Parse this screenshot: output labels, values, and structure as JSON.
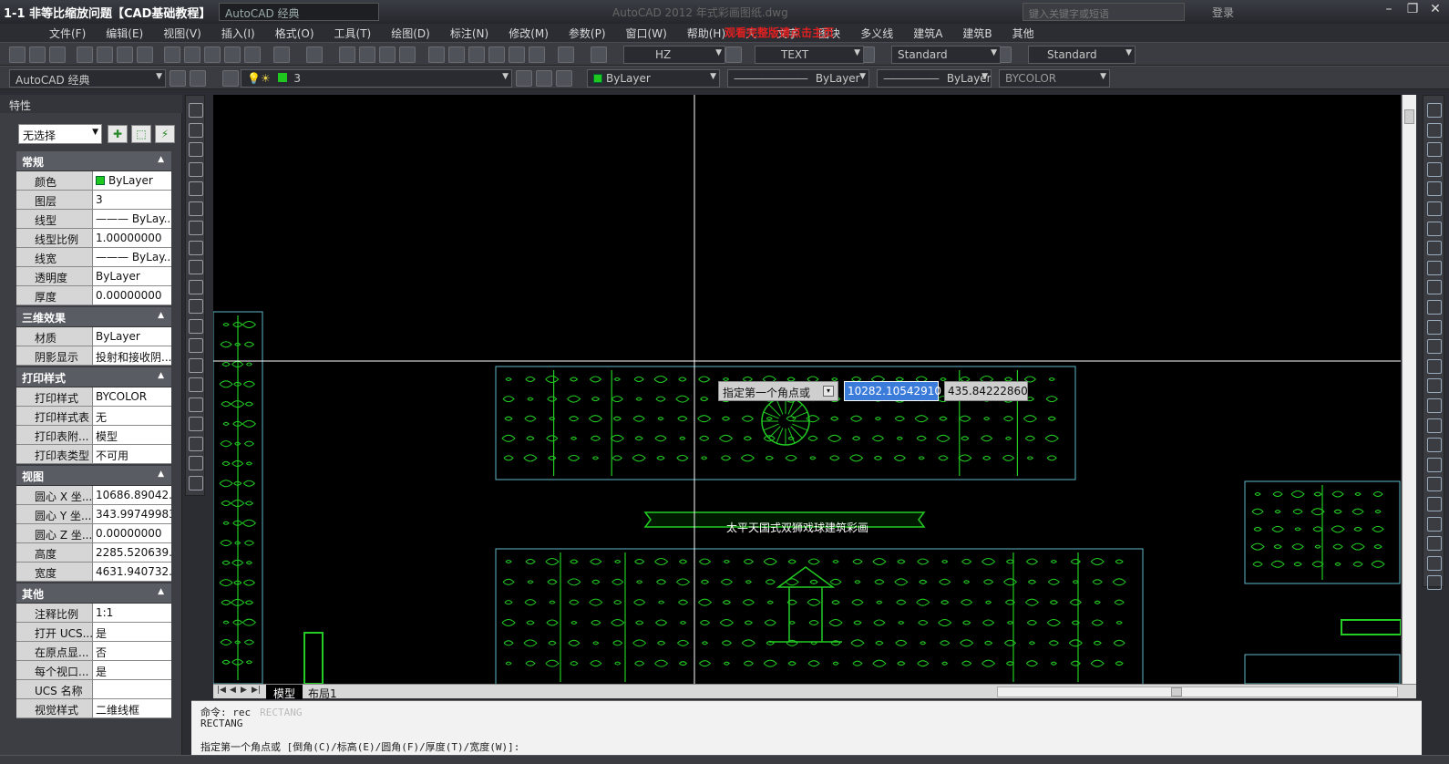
{
  "titlebar": {
    "video_title": "1-1 非等比缩放问题【CAD基础教程】",
    "workspace": "AutoCAD 经典",
    "app_title": "AutoCAD 2012   年式彩画图纸.dwg",
    "search_placeholder": "键入关键字或短语",
    "login": "登录"
  },
  "menu": {
    "items": [
      "文件(F)",
      "编辑(E)",
      "视图(V)",
      "插入(I)",
      "格式(O)",
      "工具(T)",
      "绘图(D)",
      "标注(N)",
      "修改(M)",
      "参数(P)",
      "窗口(W)",
      "帮助(H)",
      "天",
      "文字",
      "图块",
      "多义线",
      "建筑A",
      "建筑B",
      "其他"
    ],
    "red_overlay": "观看完整版请点击主页"
  },
  "toolbar1": {
    "text_style": "HZ",
    "text_name": "TEXT",
    "dim_style": "Standard",
    "table_style": "Standard"
  },
  "toolbar2": {
    "workspace": "AutoCAD 经典",
    "layer": "3",
    "color": "ByLayer",
    "linetype": "ByLayer",
    "lineweight": "ByLayer",
    "plotstyle": "BYCOLOR"
  },
  "properties": {
    "title": "特性",
    "selection": "无选择",
    "sections": [
      {
        "title": "常规",
        "rows": [
          {
            "k": "颜色",
            "v": "ByLayer",
            "swatch": true
          },
          {
            "k": "图层",
            "v": "3"
          },
          {
            "k": "线型",
            "v": "——— ByLay..."
          },
          {
            "k": "线型比例",
            "v": "1.00000000"
          },
          {
            "k": "线宽",
            "v": "——— ByLay..."
          },
          {
            "k": "透明度",
            "v": "ByLayer"
          },
          {
            "k": "厚度",
            "v": "0.00000000"
          }
        ]
      },
      {
        "title": "三维效果",
        "rows": [
          {
            "k": "材质",
            "v": "ByLayer"
          },
          {
            "k": "阴影显示",
            "v": "投射和接收阴..."
          }
        ]
      },
      {
        "title": "打印样式",
        "rows": [
          {
            "k": "打印样式",
            "v": "BYCOLOR"
          },
          {
            "k": "打印样式表",
            "v": "无"
          },
          {
            "k": "打印表附...",
            "v": "模型"
          },
          {
            "k": "打印表类型",
            "v": "不可用"
          }
        ]
      },
      {
        "title": "视图",
        "rows": [
          {
            "k": "圆心 X 坐...",
            "v": "10686.89042..."
          },
          {
            "k": "圆心 Y 坐...",
            "v": "343.99749983"
          },
          {
            "k": "圆心 Z 坐...",
            "v": "0.00000000"
          },
          {
            "k": "高度",
            "v": "2285.520639..."
          },
          {
            "k": "宽度",
            "v": "4631.940732..."
          }
        ]
      },
      {
        "title": "其他",
        "rows": [
          {
            "k": "注释比例",
            "v": "1:1"
          },
          {
            "k": "打开 UCS...",
            "v": "是"
          },
          {
            "k": "在原点显...",
            "v": "否"
          },
          {
            "k": "每个视口...",
            "v": "是"
          },
          {
            "k": "UCS 名称",
            "v": ""
          },
          {
            "k": "视觉样式",
            "v": "二维线框"
          }
        ]
      }
    ]
  },
  "canvas": {
    "prompt": "指定第一个角点或",
    "x_value": "10282.10542910",
    "y_value": "435.84222860",
    "banner": "太平天国式双狮戏球建筑彩画"
  },
  "tabs": [
    "模型",
    "布局1"
  ],
  "command": {
    "line1": "命令: rec",
    "line1_ghost": "RECTANG",
    "line2": "RECTANG",
    "line3": "指定第一个角点或 [倒角(C)/标高(E)/圆角(F)/厚度(T)/宽度(W)]:"
  },
  "colors": {
    "drawing_green": "#22cc22",
    "frame_cyan": "#5fb8c8",
    "crosshair": "#ffffff"
  }
}
